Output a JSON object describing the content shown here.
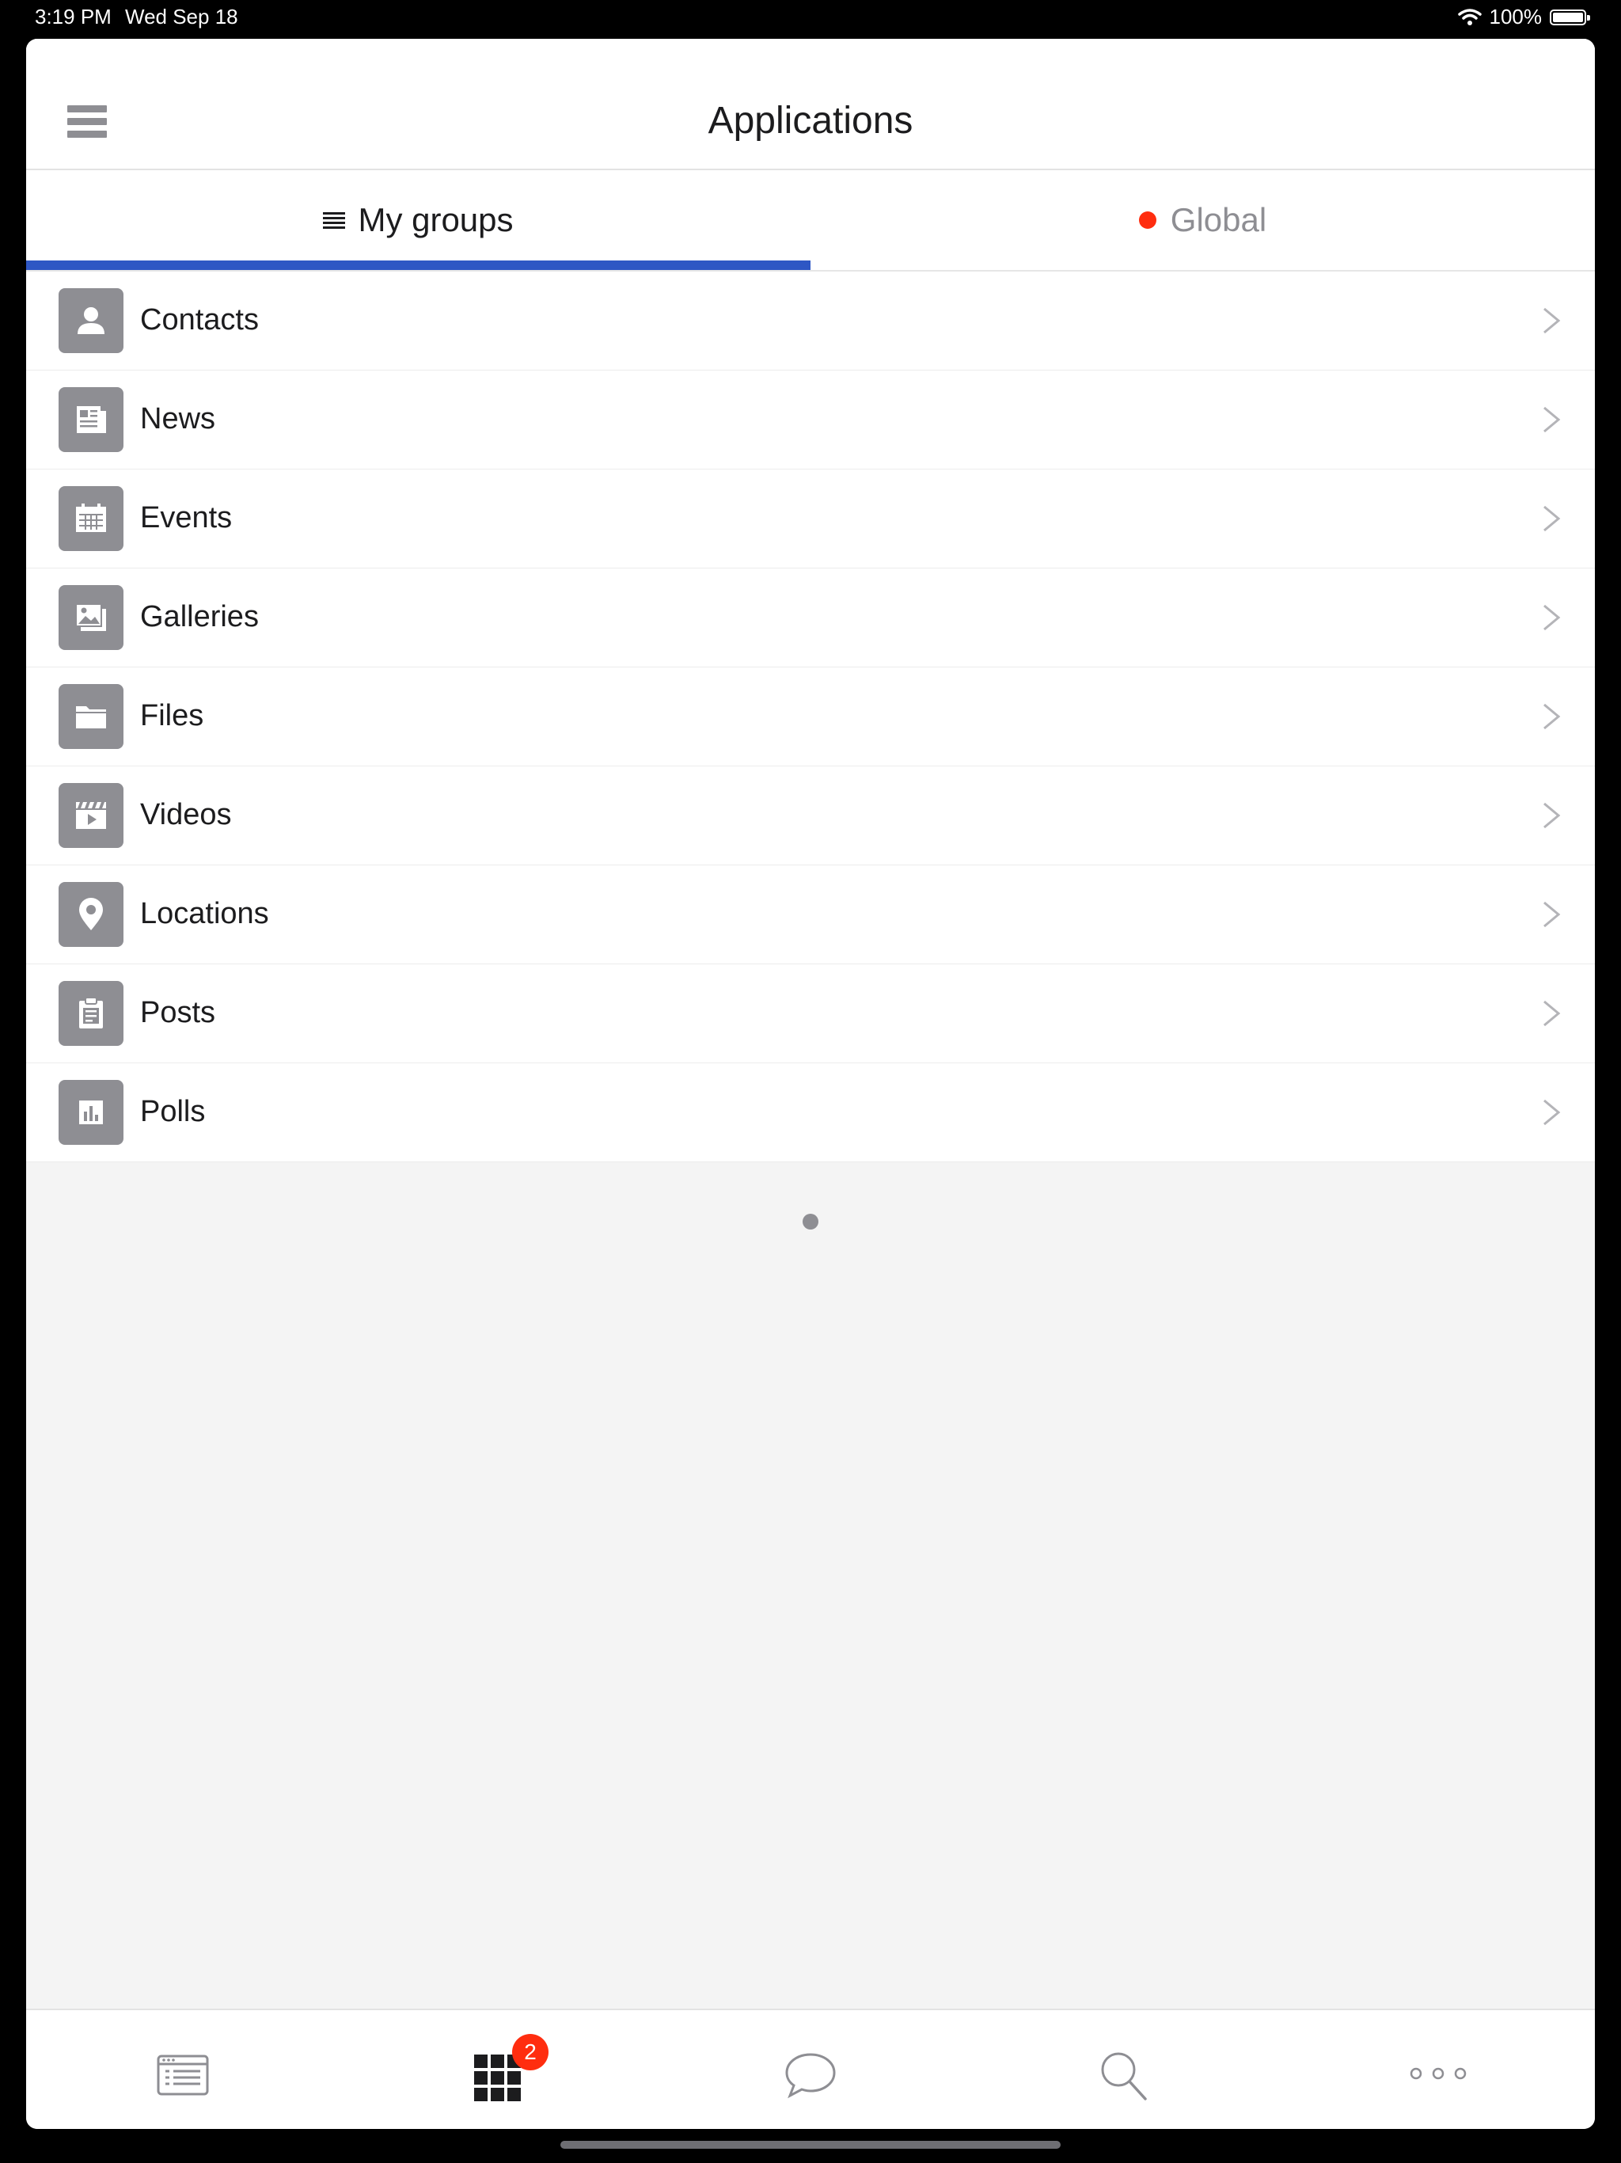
{
  "status_bar": {
    "time": "3:19 PM",
    "date": "Wed Sep 18",
    "battery": "100%",
    "wifi_icon": "wifi-icon",
    "battery_icon": "battery-icon"
  },
  "header": {
    "title": "Applications",
    "menu_icon": "hamburger-menu-icon"
  },
  "tabs": [
    {
      "label": "My groups",
      "active": true,
      "icon": "list-lines-icon"
    },
    {
      "label": "Global",
      "active": false,
      "icon": "red-dot-icon"
    }
  ],
  "colors": {
    "accent": "#2e57c4",
    "badge": "#ff2d0f",
    "icon_gray": "#8e8e93"
  },
  "apps": [
    {
      "label": "Contacts",
      "icon": "contact-card-icon"
    },
    {
      "label": "News",
      "icon": "newspaper-icon"
    },
    {
      "label": "Events",
      "icon": "calendar-icon"
    },
    {
      "label": "Galleries",
      "icon": "photo-gallery-icon"
    },
    {
      "label": "Files",
      "icon": "folder-icon"
    },
    {
      "label": "Videos",
      "icon": "video-clapper-icon"
    },
    {
      "label": "Locations",
      "icon": "map-pin-icon"
    },
    {
      "label": "Posts",
      "icon": "clipboard-icon"
    },
    {
      "label": "Polls",
      "icon": "bar-chart-icon"
    }
  ],
  "tab_bar": {
    "items": [
      {
        "name": "feed",
        "icon": "feed-list-icon"
      },
      {
        "name": "applications",
        "icon": "grid-apps-icon",
        "badge": "2",
        "active": true
      },
      {
        "name": "messages",
        "icon": "chat-bubble-icon"
      },
      {
        "name": "search",
        "icon": "search-icon"
      },
      {
        "name": "more",
        "icon": "more-dots-icon"
      }
    ]
  }
}
